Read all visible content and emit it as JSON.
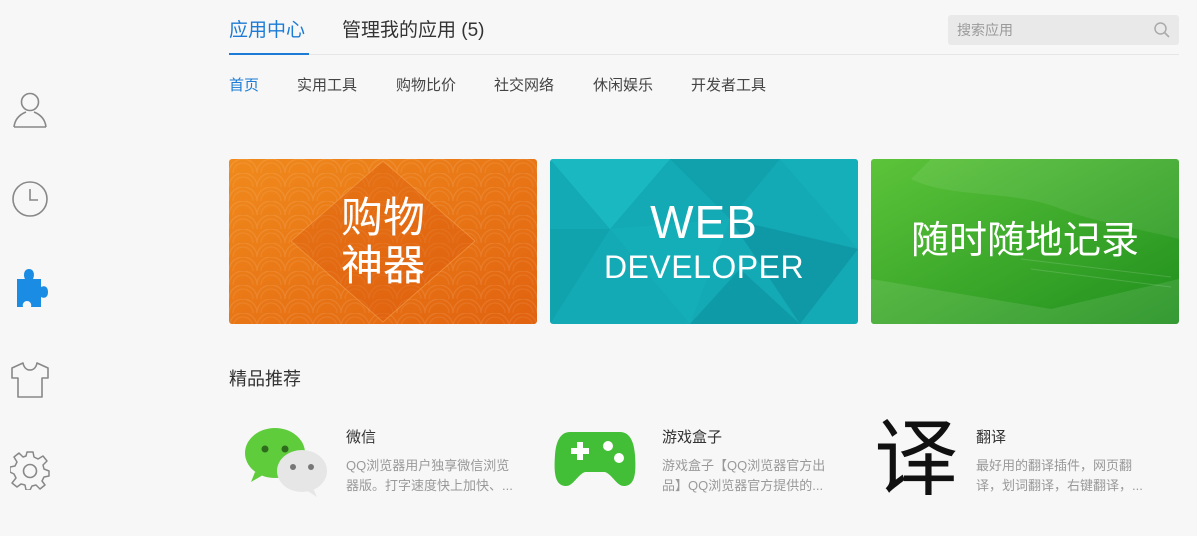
{
  "sidebar": {
    "items": [
      {
        "icon": "user-icon"
      },
      {
        "icon": "clock-icon"
      },
      {
        "icon": "puzzle-icon",
        "active": true
      },
      {
        "icon": "shirt-icon"
      },
      {
        "icon": "gear-icon"
      }
    ],
    "accent": "#1b8ce3"
  },
  "header": {
    "tabs": [
      {
        "label": "应用中心",
        "active": true
      },
      {
        "label": "管理我的应用 (5)",
        "active": false
      }
    ],
    "search": {
      "placeholder": "搜索应用",
      "value": ""
    }
  },
  "categories": [
    {
      "label": "首页",
      "active": true
    },
    {
      "label": "实用工具"
    },
    {
      "label": "购物比价"
    },
    {
      "label": "社交网络"
    },
    {
      "label": "休闲娱乐"
    },
    {
      "label": "开发者工具"
    }
  ],
  "banners": [
    {
      "line1": "购物",
      "line2": "神器",
      "color": "#e8761a"
    },
    {
      "line1": "WEB",
      "line2": "DEVELOPER",
      "color": "#12a9b3"
    },
    {
      "line1": "随时随地记录",
      "color": "#3cab2a"
    }
  ],
  "section": {
    "title": "精品推荐"
  },
  "apps": [
    {
      "name": "微信",
      "desc": "QQ浏览器用户独享微信浏览器版。打字速度快上加快、...",
      "icon": "wechat-icon"
    },
    {
      "name": "游戏盒子",
      "desc": "游戏盒子【QQ浏览器官方出品】QQ浏览器官方提供的...",
      "icon": "gamepad-icon"
    },
    {
      "name": "翻译",
      "desc": "最好用的翻译插件，网页翻译，划词翻译，右键翻译，...",
      "icon": "translate-icon",
      "glyph": "译"
    }
  ],
  "colors": {
    "accent": "#1b7bd6",
    "background": "#f7f7f7"
  }
}
